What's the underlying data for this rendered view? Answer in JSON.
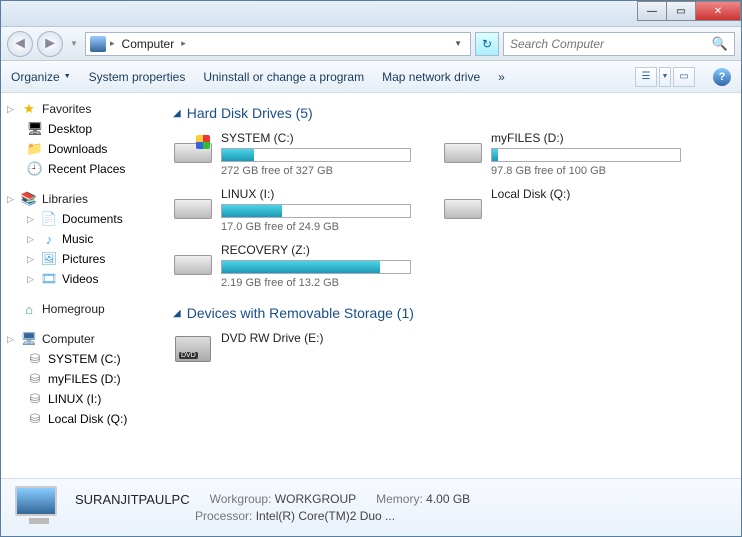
{
  "window": {
    "minimize": "—",
    "maximize": "▭",
    "close": "✕"
  },
  "nav": {
    "back": "◄",
    "fwd": "►",
    "hist": "▼",
    "crumb_icon": "computer",
    "crumb1": "Computer",
    "sep": "▸",
    "drop": "▼",
    "refresh": "↻",
    "search_placeholder": "Search Computer",
    "search_icon": "🔍"
  },
  "toolbar": {
    "organize": "Organize",
    "sysprops": "System properties",
    "uninstall": "Uninstall or change a program",
    "mapdrive": "Map network drive",
    "more": "»",
    "help": "?"
  },
  "tree": {
    "favorites": {
      "label": "Favorites",
      "items": [
        {
          "icon": "🖥",
          "label": "Desktop"
        },
        {
          "icon": "📁",
          "label": "Downloads"
        },
        {
          "icon": "🕘",
          "label": "Recent Places"
        }
      ]
    },
    "libraries": {
      "label": "Libraries",
      "items": [
        {
          "icon": "📄",
          "label": "Documents"
        },
        {
          "icon": "♪",
          "label": "Music"
        },
        {
          "icon": "🖼",
          "label": "Pictures"
        },
        {
          "icon": "🎞",
          "label": "Videos"
        }
      ]
    },
    "homegroup": {
      "label": "Homegroup"
    },
    "computer": {
      "label": "Computer",
      "items": [
        {
          "label": "SYSTEM (C:)"
        },
        {
          "label": "myFILES (D:)"
        },
        {
          "label": "LINUX (I:)"
        },
        {
          "label": "Local Disk (Q:)"
        }
      ]
    }
  },
  "content": {
    "group1": {
      "title": "Hard Disk Drives (5)"
    },
    "drives": [
      {
        "name": "SYSTEM (C:)",
        "free": "272 GB free of 327 GB",
        "fill": 17,
        "win": true
      },
      {
        "name": "myFILES (D:)",
        "free": "97.8 GB free of 100 GB",
        "fill": 3,
        "win": false
      },
      {
        "name": "LINUX (I:)",
        "free": "17.0 GB free of 24.9 GB",
        "fill": 32,
        "win": false
      },
      {
        "name": "Local Disk (Q:)",
        "free": "",
        "fill": null,
        "win": false
      },
      {
        "name": "RECOVERY (Z:)",
        "free": "2.19 GB free of 13.2 GB",
        "fill": 84,
        "win": false
      }
    ],
    "group2": {
      "title": "Devices with Removable Storage (1)"
    },
    "removable": [
      {
        "name": "DVD RW Drive (E:)"
      }
    ]
  },
  "details": {
    "name": "SURANJITPAULPC",
    "workgroup_lbl": "Workgroup:",
    "workgroup": "WORKGROUP",
    "memory_lbl": "Memory:",
    "memory": "4.00 GB",
    "processor_lbl": "Processor:",
    "processor": "Intel(R) Core(TM)2 Duo ..."
  }
}
